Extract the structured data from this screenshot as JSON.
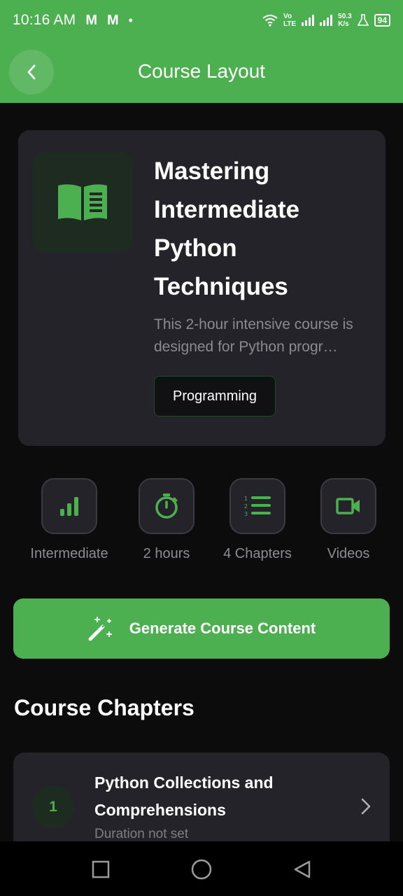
{
  "status_bar": {
    "time": "10:16 AM",
    "mail_icons": [
      "M",
      "M"
    ],
    "dot": "•",
    "volte": [
      "Vo",
      "LTE"
    ],
    "speed": [
      "50.3",
      "K/s"
    ],
    "battery": "94"
  },
  "app_bar": {
    "title": "Course Layout",
    "back_icon": "chevron-left-icon"
  },
  "course": {
    "icon": "book-icon",
    "title": "Mastering Intermediate Python Techniques",
    "description": "This 2-hour intensive course is designed for Python progr…",
    "category": "Programming"
  },
  "stats": [
    {
      "icon": "bar-chart-icon",
      "label": "Intermediate"
    },
    {
      "icon": "stopwatch-icon",
      "label": "2 hours"
    },
    {
      "icon": "numbered-list-icon",
      "label": "4 Chapters"
    },
    {
      "icon": "video-camera-icon",
      "label": "Videos"
    }
  ],
  "generate_button": {
    "icon": "magic-wand-icon",
    "label": "Generate Course Content"
  },
  "chapters_section": {
    "title": "Course Chapters"
  },
  "chapters": [
    {
      "number": "1",
      "title": "Python Collections and Comprehensions",
      "duration": "Duration not set"
    }
  ],
  "colors": {
    "accent": "#4caf50",
    "background": "#0c0c0d",
    "card": "#232329",
    "muted_text": "#8a8a90"
  }
}
